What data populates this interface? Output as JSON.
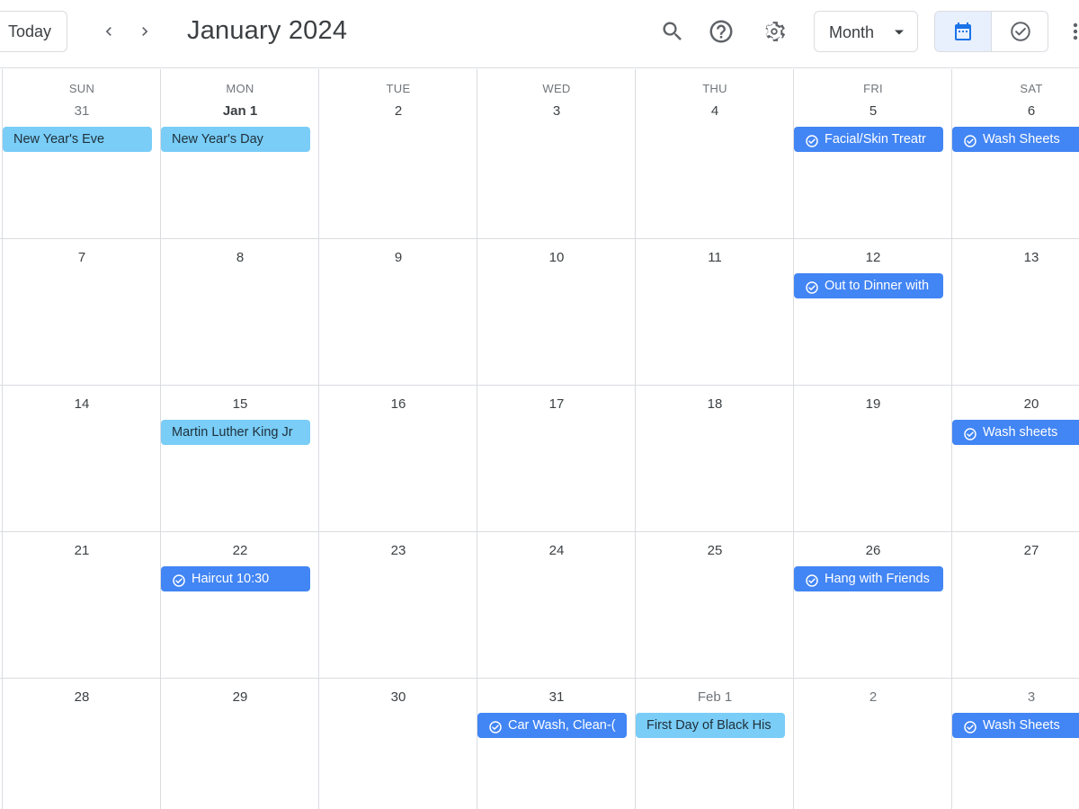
{
  "header": {
    "today_label": "Today",
    "month_title": "January 2024",
    "view_label": "Month",
    "icons": [
      "chevron-left-icon",
      "chevron-right-icon",
      "search-icon",
      "help-icon",
      "settings-icon",
      "caret-down-icon",
      "calendar-icon",
      "task-check-icon",
      "more-vert-icon"
    ]
  },
  "colors": {
    "holiday": "#79cdf7",
    "task": "#4285f4",
    "active_toggle": "#e8f0fe",
    "grid_line": "#dadce0",
    "icon": "#5f6368"
  },
  "weekdays": [
    "SUN",
    "MON",
    "TUE",
    "WED",
    "THU",
    "FRI",
    "SAT"
  ],
  "weeks": [
    {
      "days": [
        "31",
        "Jan 1",
        "2",
        "3",
        "4",
        "5",
        "6"
      ],
      "events": [
        {
          "day": 0,
          "title": "New Year's Eve",
          "type": "holiday"
        },
        {
          "day": 1,
          "title": "New Year's Day",
          "type": "holiday"
        },
        {
          "day": 5,
          "title": "Facial/Skin Treatr",
          "type": "task"
        },
        {
          "day": 6,
          "title": "Wash Sheets",
          "type": "task"
        }
      ]
    },
    {
      "days": [
        "7",
        "8",
        "9",
        "10",
        "11",
        "12",
        "13"
      ],
      "events": [
        {
          "day": 5,
          "title": "Out to Dinner with",
          "type": "task"
        }
      ]
    },
    {
      "days": [
        "14",
        "15",
        "16",
        "17",
        "18",
        "19",
        "20"
      ],
      "events": [
        {
          "day": 1,
          "title": "Martin Luther King Jr",
          "type": "holiday"
        },
        {
          "day": 6,
          "title": "Wash sheets",
          "type": "task"
        }
      ]
    },
    {
      "days": [
        "21",
        "22",
        "23",
        "24",
        "25",
        "26",
        "27"
      ],
      "events": [
        {
          "day": 1,
          "title": "Haircut 10:30",
          "type": "task"
        },
        {
          "day": 5,
          "title": "Hang with Friends",
          "type": "task"
        }
      ]
    },
    {
      "days": [
        "28",
        "29",
        "30",
        "31",
        "Feb 1",
        "2",
        "3"
      ],
      "events": [
        {
          "day": 3,
          "title": "Car Wash, Clean-(",
          "type": "task"
        },
        {
          "day": 4,
          "title": "First Day of Black His",
          "type": "holiday"
        },
        {
          "day": 6,
          "title": "Wash Sheets",
          "type": "task"
        }
      ]
    }
  ]
}
